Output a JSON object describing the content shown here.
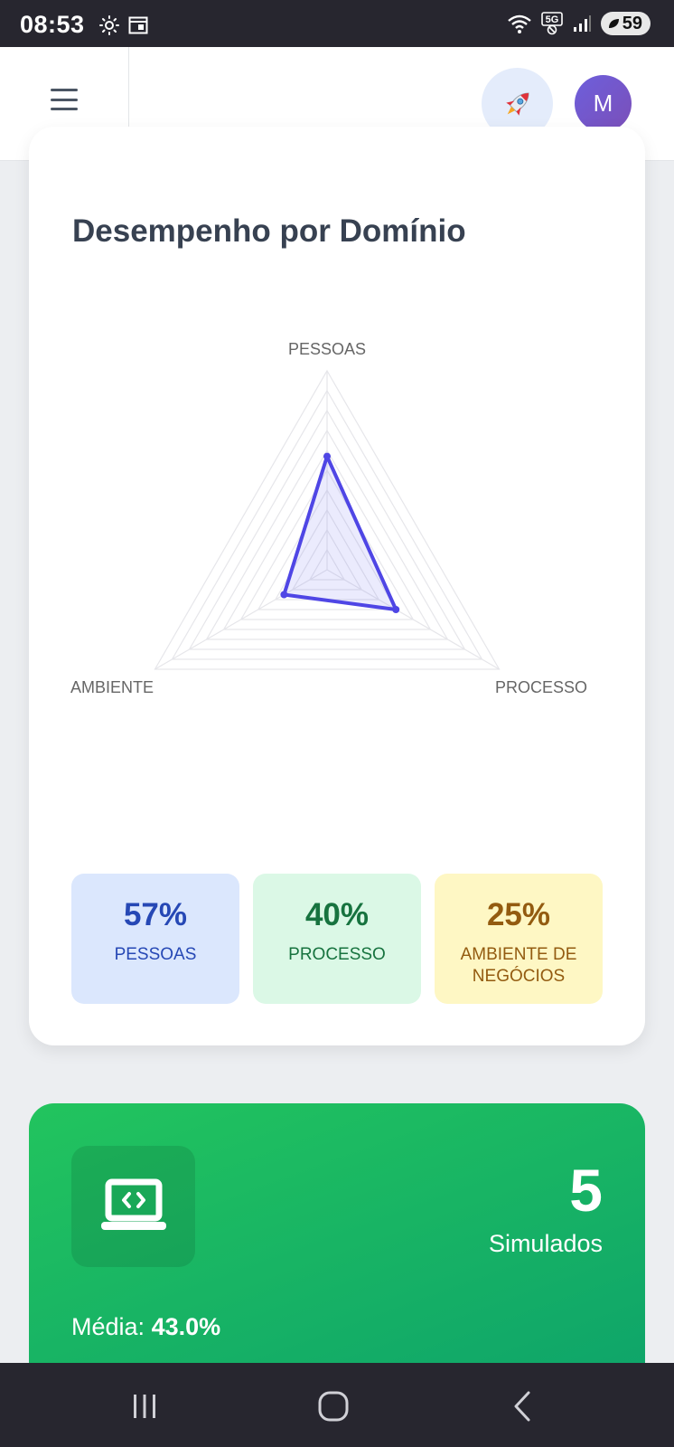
{
  "status_bar": {
    "time": "08:53",
    "battery": "59",
    "network": "5G"
  },
  "header": {
    "menu_icon": "hamburger-menu-icon",
    "rocket_icon": "rocket-icon",
    "avatar_initial": "M"
  },
  "performance": {
    "title": "Desempenho por Domínio",
    "chart_data": {
      "type": "radar",
      "categories": [
        "PESSOAS",
        "PROCESSO",
        "AMBIENTE"
      ],
      "values": [
        57,
        40,
        25
      ],
      "range": [
        0,
        100
      ],
      "series_color": "#4f46e5",
      "grid": true
    },
    "tiles": [
      {
        "value": "57%",
        "label": "PESSOAS",
        "color": "#2648b5"
      },
      {
        "value": "40%",
        "label": "PROCESSO",
        "color": "#17733f"
      },
      {
        "value": "25%",
        "label": "AMBIENTE DE NEGÓCIOS",
        "color": "#935b10"
      }
    ]
  },
  "exams": {
    "icon": "laptop-code-icon",
    "count": "5",
    "label": "Simulados",
    "average_label": "Média:",
    "average_value": "43.0%"
  },
  "nav_bar": {
    "recents_icon": "recents-icon",
    "home_icon": "home-icon",
    "back_icon": "back-icon"
  }
}
